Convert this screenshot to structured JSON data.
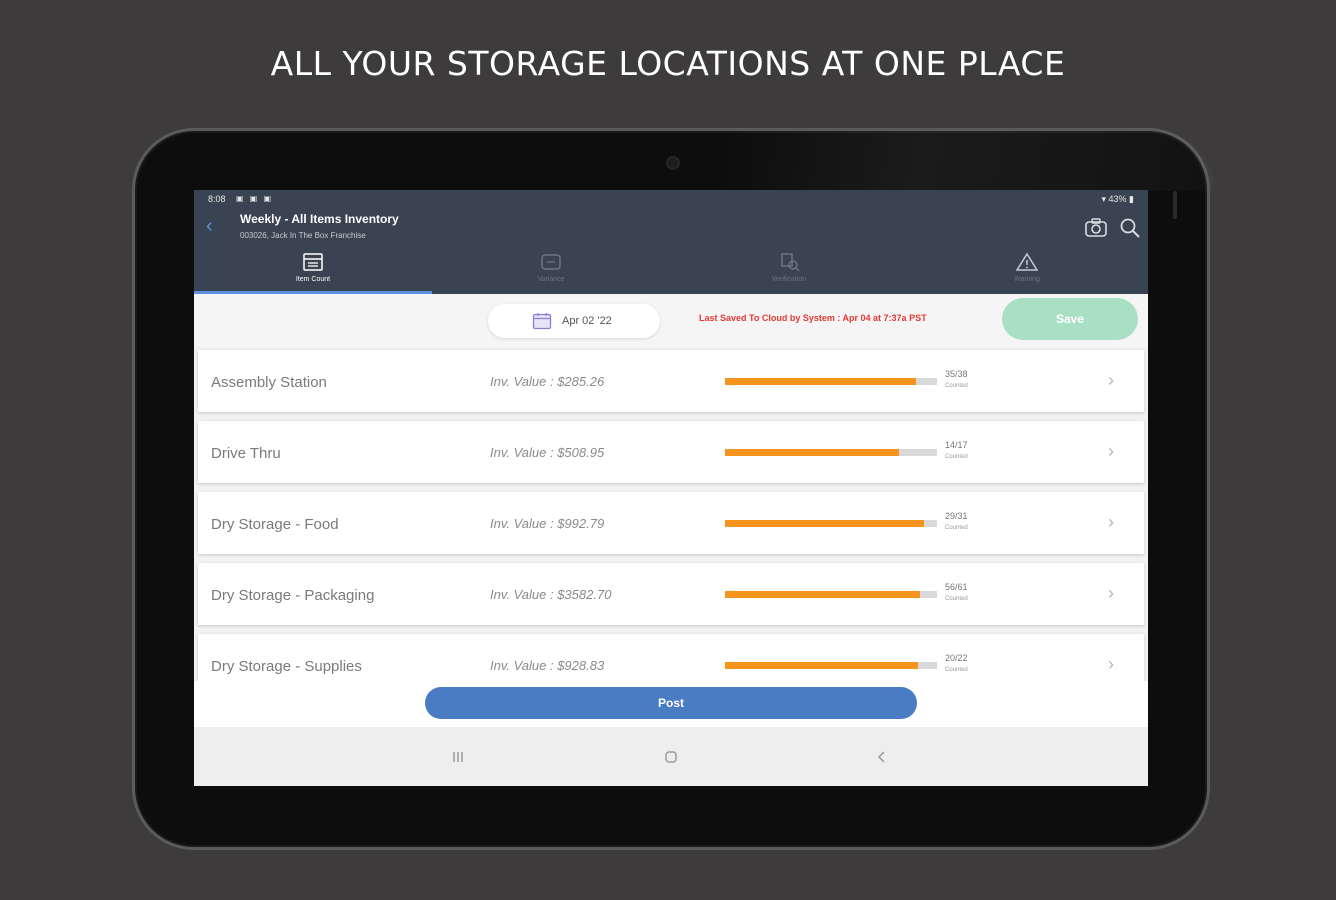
{
  "headline": "ALL YOUR STORAGE LOCATIONS AT ONE PLACE",
  "status_bar": {
    "time": "8:08",
    "battery": "43%"
  },
  "header": {
    "title": "Weekly - All Items Inventory",
    "subtitle": "003026, Jack In The Box Franchise",
    "back_icon": "chevron-left-icon",
    "right_icons": [
      "camera-icon",
      "search-icon"
    ]
  },
  "tabs": [
    {
      "label": "Item Count",
      "icon": "list-box-icon",
      "active": true
    },
    {
      "label": "Variance",
      "icon": "variance-icon",
      "active": false
    },
    {
      "label": "Verification",
      "icon": "verification-icon",
      "active": false
    },
    {
      "label": "Warning",
      "icon": "warning-icon",
      "active": false
    }
  ],
  "toolbar": {
    "date": "Apr 02 '22",
    "last_saved": "Last Saved To Cloud by System : Apr 04 at 7:37a PST",
    "save_label": "Save"
  },
  "locations": [
    {
      "name": "Assembly Station",
      "inv_value": "Inv. Value : $285.26",
      "count": "35/38",
      "count_label": "Counted",
      "progress": 0.9
    },
    {
      "name": "Drive Thru",
      "inv_value": "Inv. Value : $508.95",
      "count": "14/17",
      "count_label": "Counted",
      "progress": 0.82
    },
    {
      "name": "Dry Storage - Food",
      "inv_value": "Inv. Value : $992.79",
      "count": "29/31",
      "count_label": "Counted",
      "progress": 0.94
    },
    {
      "name": "Dry Storage - Packaging",
      "inv_value": "Inv. Value : $3582.70",
      "count": "56/61",
      "count_label": "Counted",
      "progress": 0.92
    },
    {
      "name": "Dry Storage - Supplies",
      "inv_value": "Inv. Value : $928.83",
      "count": "20/22",
      "count_label": "Counted",
      "progress": 0.91
    }
  ],
  "post_label": "Post",
  "nav_buttons": [
    "recent-apps-icon",
    "home-icon",
    "back-icon"
  ],
  "colors": {
    "appbar": "#3a4351",
    "accent_blue": "#4a7cc4",
    "progress_orange": "#f7941d",
    "save_green": "#a9e0c4",
    "alert_red": "#e53935"
  }
}
